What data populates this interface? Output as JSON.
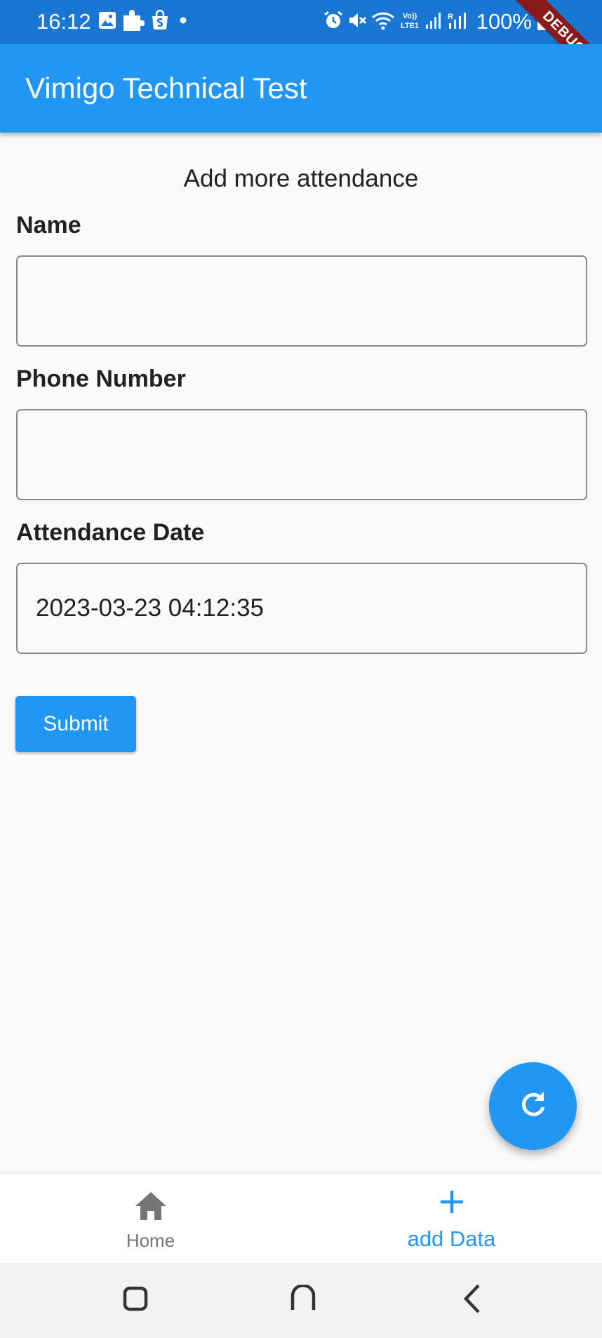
{
  "status_bar": {
    "time": "16:12",
    "battery": "100%",
    "left_icons": [
      "gallery-icon",
      "puzzle-icon",
      "shop-bag-icon",
      "dot-icon"
    ],
    "right_icons": [
      "alarm-icon",
      "mute-icon",
      "wifi-icon",
      "volte-icon",
      "signal-icon",
      "signal-r-icon",
      "battery-icon"
    ]
  },
  "debug_banner": "DEBUG",
  "app_bar": {
    "title": "Vimigo Technical Test"
  },
  "form": {
    "heading": "Add more attendance",
    "name": {
      "label": "Name",
      "value": "",
      "placeholder": ""
    },
    "phone": {
      "label": "Phone Number",
      "value": "",
      "placeholder": ""
    },
    "date": {
      "label": "Attendance Date",
      "value": "2023-03-23 04:12:35"
    },
    "submit_label": "Submit"
  },
  "fab": {
    "icon": "refresh-icon"
  },
  "bottom_nav": {
    "items": [
      {
        "label": "Home",
        "icon": "home-icon",
        "active": false
      },
      {
        "label": "add Data",
        "icon": "plus-icon",
        "active": true
      }
    ]
  },
  "system_nav": {
    "buttons": [
      "recents-icon",
      "home-gesture-icon",
      "back-icon"
    ]
  },
  "colors": {
    "primary": "#2196f3",
    "status_bar": "#1976d2",
    "debug_ribbon": "#8b1a1a",
    "inactive_nav": "#757575"
  }
}
